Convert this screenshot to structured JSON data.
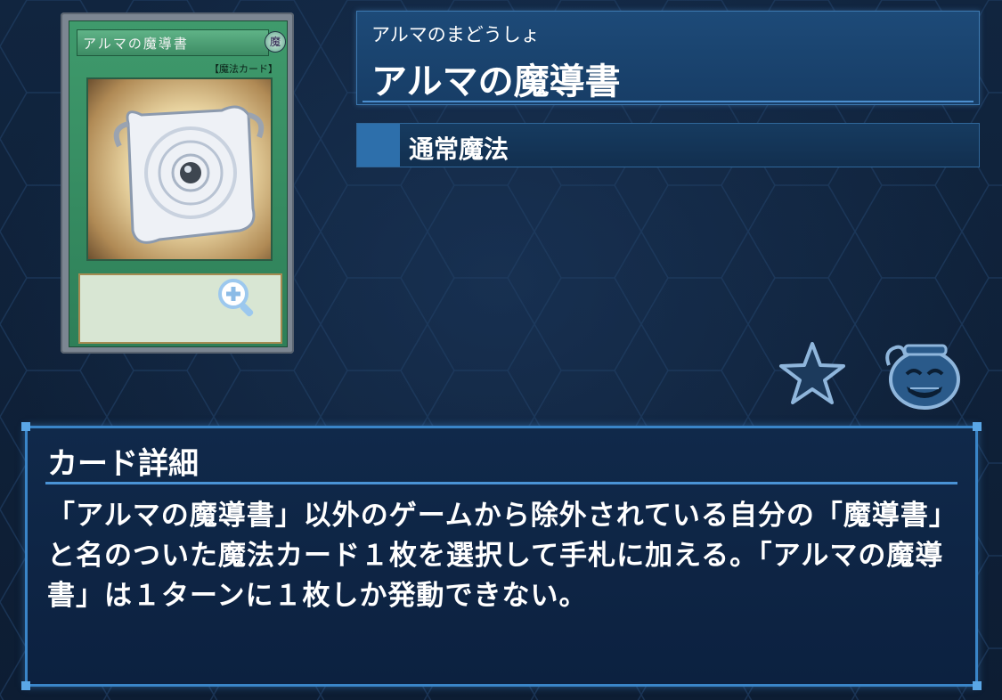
{
  "card": {
    "name": "アルマの魔導書",
    "attribute_glyph": "魔",
    "type_tag": "【魔法カード】",
    "footer": "",
    "art_icon": "grimoire-book-art"
  },
  "header": {
    "reading": "アルマのまどうしょ",
    "title": "アルマの魔導書",
    "type": "通常魔法"
  },
  "actions": {
    "zoom_icon": "zoom-in-icon",
    "favorite_icon": "star-icon",
    "pot_icon": "pot-of-greed-icon"
  },
  "details": {
    "title": "カード詳細",
    "text": "「アルマの魔導書」以外のゲームから除外されている自分の「魔導書」と名のついた魔法カード１枚を選択して手札に加える。「アルマの魔導書」は１ターンに１枚しか発動できない。"
  },
  "colors": {
    "accent": "#3a85c8",
    "panel": "#173d66",
    "card_green": "#3f9a6c"
  }
}
